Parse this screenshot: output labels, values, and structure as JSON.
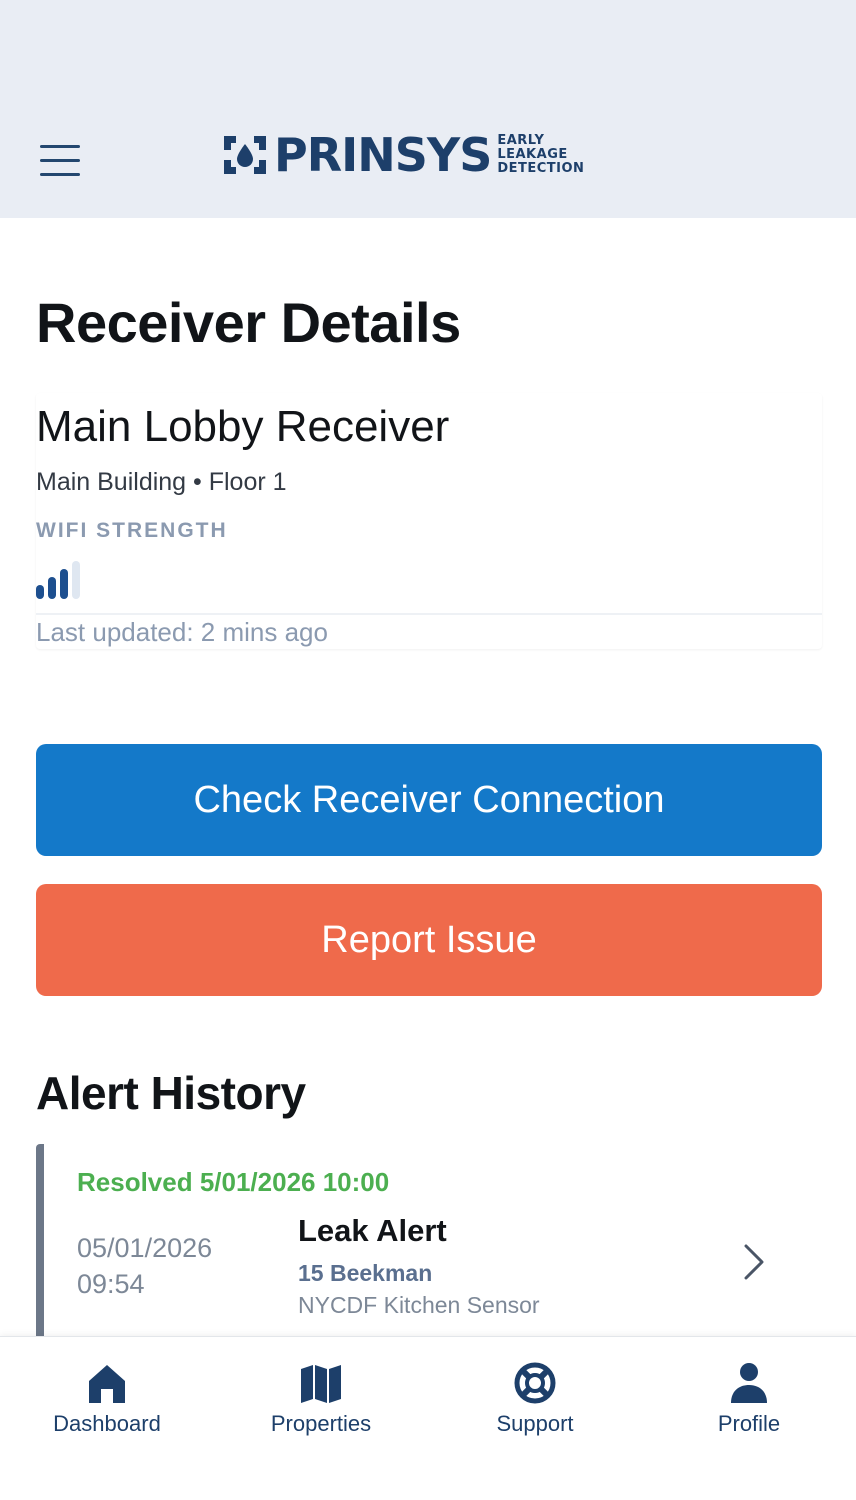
{
  "header": {
    "menu_icon": "hamburger-icon",
    "logo": {
      "wordmark": "PRINSYS",
      "tagline": [
        "EARLY",
        "LEAKAGE",
        "DETECTION"
      ],
      "color": "#1d3f6a"
    }
  },
  "page": {
    "title": "Receiver Details"
  },
  "receiver": {
    "name": "Main Lobby Receiver",
    "location": "Main Building • Floor 1",
    "wifi_label": "WIFI STRENGTH",
    "wifi_bars_active": 3,
    "wifi_bars_total": 4,
    "last_updated": "Last updated: 2 mins ago"
  },
  "actions": {
    "check_label": "Check Receiver Connection",
    "check_color": "#1479c9",
    "report_label": "Report Issue",
    "report_color": "#ef6a4b"
  },
  "alerts": {
    "title": "Alert History",
    "items": [
      {
        "status": "Resolved 5/01/2026 10:00",
        "date": "05/01/2026",
        "time": "09:54",
        "type": "Leak Alert",
        "property": "15 Beekman",
        "sensor": "NYCDF Kitchen Sensor"
      }
    ]
  },
  "nav": {
    "items": [
      {
        "label": "Dashboard",
        "icon": "home-icon"
      },
      {
        "label": "Properties",
        "icon": "map-icon"
      },
      {
        "label": "Support",
        "icon": "lifebuoy-icon"
      },
      {
        "label": "Profile",
        "icon": "person-icon"
      }
    ]
  }
}
